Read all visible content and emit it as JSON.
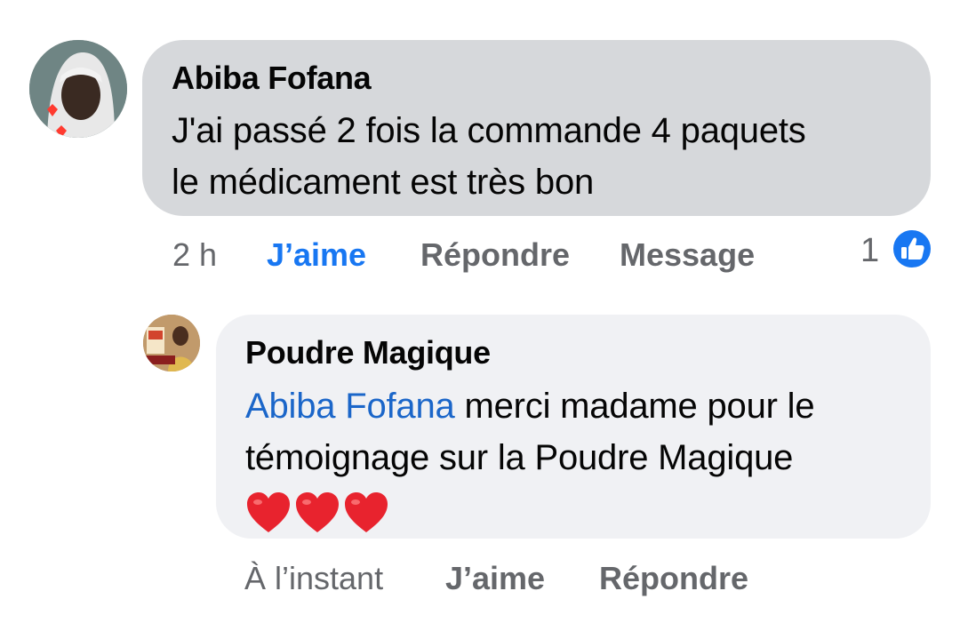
{
  "comment": {
    "author": "Abiba Fofana",
    "text_line1": "J'ai passé 2 fois la commande 4 paquets",
    "text_line2": "le médicament est très bon",
    "time": "2 h",
    "like_label": "J’aime",
    "reply_label": "Répondre",
    "message_label": "Message",
    "reaction_count": "1",
    "reaction_icon": "like-icon"
  },
  "reply": {
    "author": "Poudre Magique",
    "mention": "Abiba Fofana",
    "text_rest": " merci madame pour le témoignage sur la Poudre Magique",
    "emojis": "❤❤❤",
    "time": "À l’instant",
    "like_label": "J’aime",
    "reply_label": "Répondre"
  },
  "colors": {
    "bubble_comment": "#d6d8db",
    "bubble_reply": "#f0f1f4",
    "link_blue": "#1b66c9",
    "liked_blue": "#1877f2",
    "meta_gray": "#65676b"
  }
}
